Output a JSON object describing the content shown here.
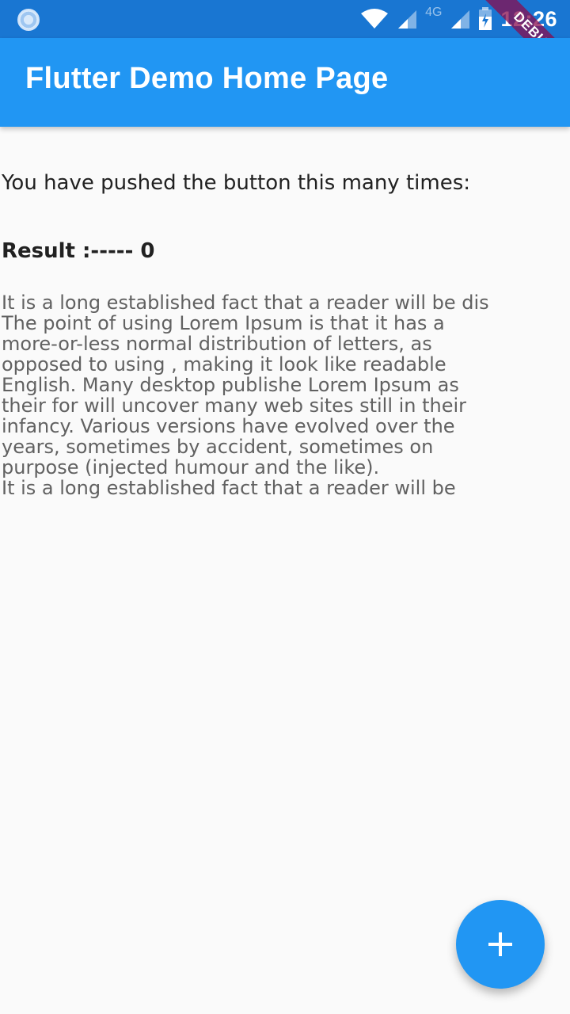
{
  "status_bar": {
    "time": "12:26",
    "network_label": "4G",
    "icons": [
      "loading-spinner-icon",
      "wifi-icon",
      "signal-icon",
      "signal-icon",
      "battery-charging-icon"
    ]
  },
  "debug_banner": "DEBUG",
  "app_bar": {
    "title": "Flutter Demo Home Page"
  },
  "body": {
    "counter_text": "You have pushed the button this many times:",
    "result_text": "Result :----- 0",
    "lorem_lines": [
      "It is a long established fact that a reader will be dis",
      "The point of using Lorem Ipsum is that it has a",
      "more-or-less normal distribution of letters, as",
      "opposed to using , making it look like readable",
      "English. Many desktop publishe Lorem Ipsum as",
      "their  for  will uncover many web sites still in their",
      "infancy. Various versions have evolved over the",
      "years, sometimes by accident, sometimes on",
      "purpose (injected humour and the like).",
      "It is a long established fact that a reader will be"
    ]
  },
  "fab": {
    "icon": "add-icon"
  },
  "colors": {
    "status_bar": "#1976d2",
    "app_bar": "#2196f3",
    "fab": "#2196f3",
    "background": "#fafafa",
    "debug_banner": "#880e4f"
  }
}
